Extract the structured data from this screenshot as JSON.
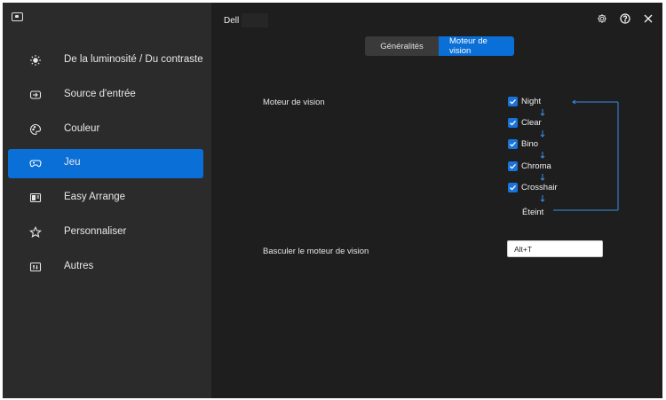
{
  "sidebar": {
    "app_icon": "monitor-icon",
    "items": [
      {
        "label": "De la luminosité / Du contraste",
        "icon": "brightness-icon"
      },
      {
        "label": "Source d'entrée",
        "icon": "input-source-icon"
      },
      {
        "label": "Couleur",
        "icon": "color-palette-icon"
      },
      {
        "label": "Jeu",
        "icon": "gamepad-icon",
        "active": true
      },
      {
        "label": "Easy Arrange",
        "icon": "layout-icon"
      },
      {
        "label": "Personnaliser",
        "icon": "star-icon"
      },
      {
        "label": "Autres",
        "icon": "others-icon"
      }
    ]
  },
  "header": {
    "monitor_name": "Dell",
    "icons": [
      "settings-icon",
      "help-icon",
      "close-icon"
    ]
  },
  "tabs": [
    {
      "label": "Généralités",
      "active": false
    },
    {
      "label": "Moteur de vision",
      "active": true
    }
  ],
  "vision_engine": {
    "label": "Moteur de vision",
    "options": [
      {
        "label": "Night",
        "checked": true
      },
      {
        "label": "Clear",
        "checked": true
      },
      {
        "label": "Bino",
        "checked": true
      },
      {
        "label": "Chroma",
        "checked": true
      },
      {
        "label": "Crosshair",
        "checked": true
      }
    ],
    "off_label": "Éteint"
  },
  "toggle": {
    "label": "Basculer le moteur de vision",
    "shortcut_value": "Alt+T"
  },
  "colors": {
    "accent": "#0a6fd6",
    "sidebar_bg": "#2b2b2b",
    "main_bg": "#1e1e1e"
  }
}
